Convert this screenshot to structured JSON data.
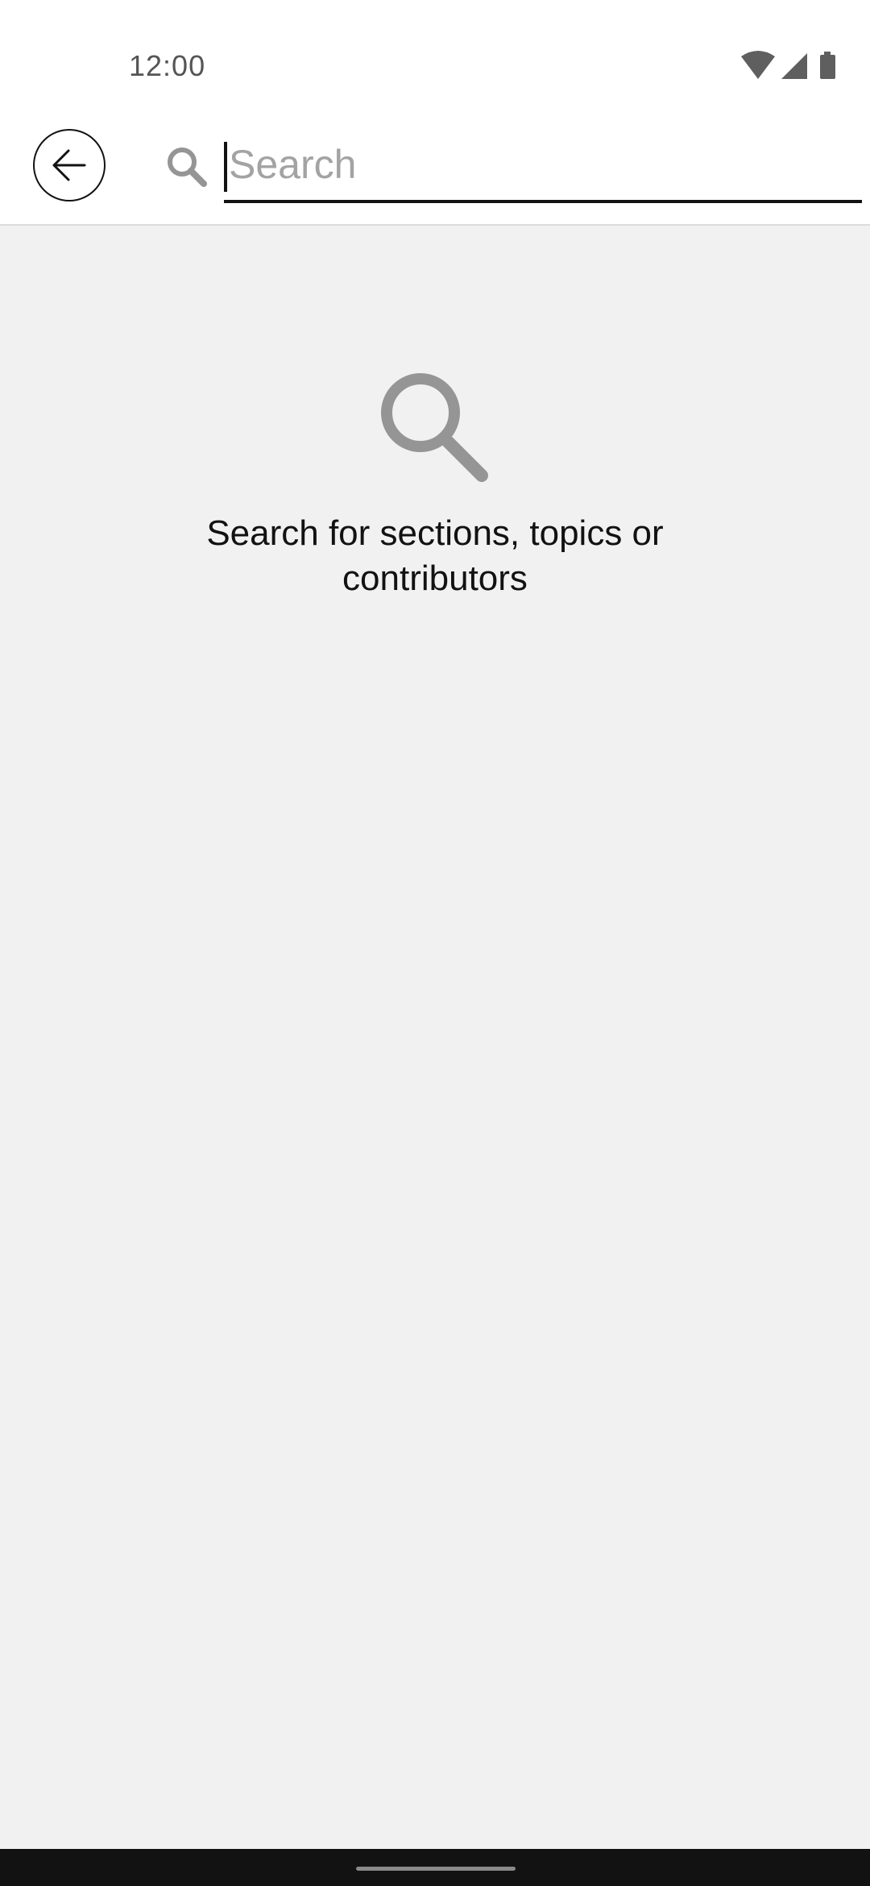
{
  "status_bar": {
    "time": "12:00",
    "icons": [
      "wifi-icon",
      "cellular-signal-icon",
      "battery-icon"
    ]
  },
  "header": {
    "back_icon": "arrow-left-icon",
    "search_icon": "search-icon",
    "search": {
      "placeholder": "Search",
      "value": ""
    }
  },
  "empty_state": {
    "icon": "search-icon",
    "message": "Search for sections, topics or contributors"
  },
  "colors": {
    "background": "#f1f1f1",
    "header_background": "#ffffff",
    "text": "#121212",
    "icon_gray": "#959595",
    "placeholder": "#a3a3a3"
  }
}
